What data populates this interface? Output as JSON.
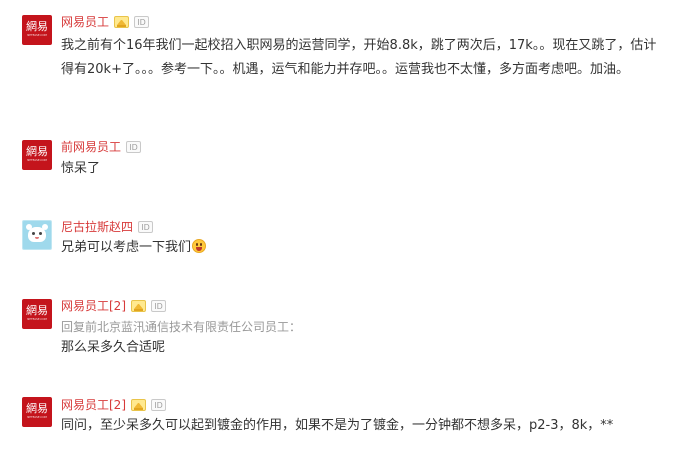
{
  "icons": {
    "vip_badge": "vip-badge-icon",
    "id_badge": "id-badge-icon",
    "avatar_netease": "netease-logo-avatar",
    "avatar_mascot": "cartoon-mascot-avatar",
    "laugh_emoji": "laughing-emoji-icon"
  },
  "colors": {
    "username": "#d73a3a",
    "content": "#333333",
    "reply_meta": "#999999",
    "netease_red": "#c4141c"
  },
  "badges": {
    "id_text": "ID"
  },
  "comments": [
    {
      "avatar_logo": "網易",
      "avatar_logo_sub": "NETEASE.COM",
      "username": "网易员工",
      "has_vip": true,
      "content": "我之前有个16年我们一起校招入职网易的运营同学，开始8.8k，跳了两次后，17k。。现在又跳了，估计得有20k+了。。。参考一下。。机遇，运气和能力并存吧。。运营我也不太懂，多方面考虑吧。加油。"
    },
    {
      "avatar_logo": "網易",
      "avatar_logo_sub": "NETEASE.COM",
      "username": "前网易员工",
      "has_vip": false,
      "content": "惊呆了"
    },
    {
      "username": "尼古拉斯赵四",
      "has_vip": false,
      "content": "兄弟可以考虑一下我们"
    },
    {
      "avatar_logo": "網易",
      "avatar_logo_sub": "NETEASE.COM",
      "username": "网易员工[2]",
      "has_vip": true,
      "reply_to": "回复前北京蓝汛通信技术有限责任公司员工：",
      "content": "那么呆多久合适呢"
    },
    {
      "avatar_logo": "網易",
      "avatar_logo_sub": "NETEASE.COM",
      "username": "网易员工[2]",
      "has_vip": true,
      "content": "同问，至少呆多久可以起到镀金的作用，如果不是为了镀金，一分钟都不想多呆，p2-3，8k，**"
    }
  ]
}
